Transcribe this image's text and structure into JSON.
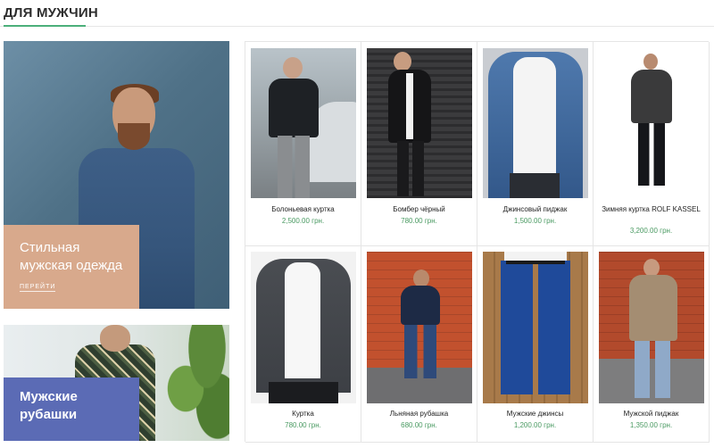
{
  "section": {
    "title": "ДЛЯ МУЖЧИН"
  },
  "promos": [
    {
      "title_line1": "Стильная",
      "title_line2": "мужская одежда",
      "link": "ПЕРЕЙТИ"
    },
    {
      "title_line1": "Мужские",
      "title_line2": "рубашки"
    }
  ],
  "products": [
    {
      "name": "Болоньевая куртка",
      "price": "2,500.00 грн."
    },
    {
      "name": "Бомбер чёрный",
      "price": "780.00 грн."
    },
    {
      "name": "Джинсовый пиджак",
      "price": "1,500.00 грн."
    },
    {
      "name": "Зимняя куртка ROLF KASSEL",
      "price": "3,200.00 грн."
    },
    {
      "name": "Куртка",
      "price": "780.00 грн."
    },
    {
      "name": "Льняная рубашка",
      "price": "680.00 грн."
    },
    {
      "name": "Мужские джинсы",
      "price": "1,200.00 грн."
    },
    {
      "name": "Мужской пиджак",
      "price": "1,350.00 грн."
    }
  ],
  "colors": {
    "accent": "#4caf7a",
    "price": "#4a9a62",
    "promo1": "#d8a98c",
    "promo2": "#5b6bb5"
  }
}
